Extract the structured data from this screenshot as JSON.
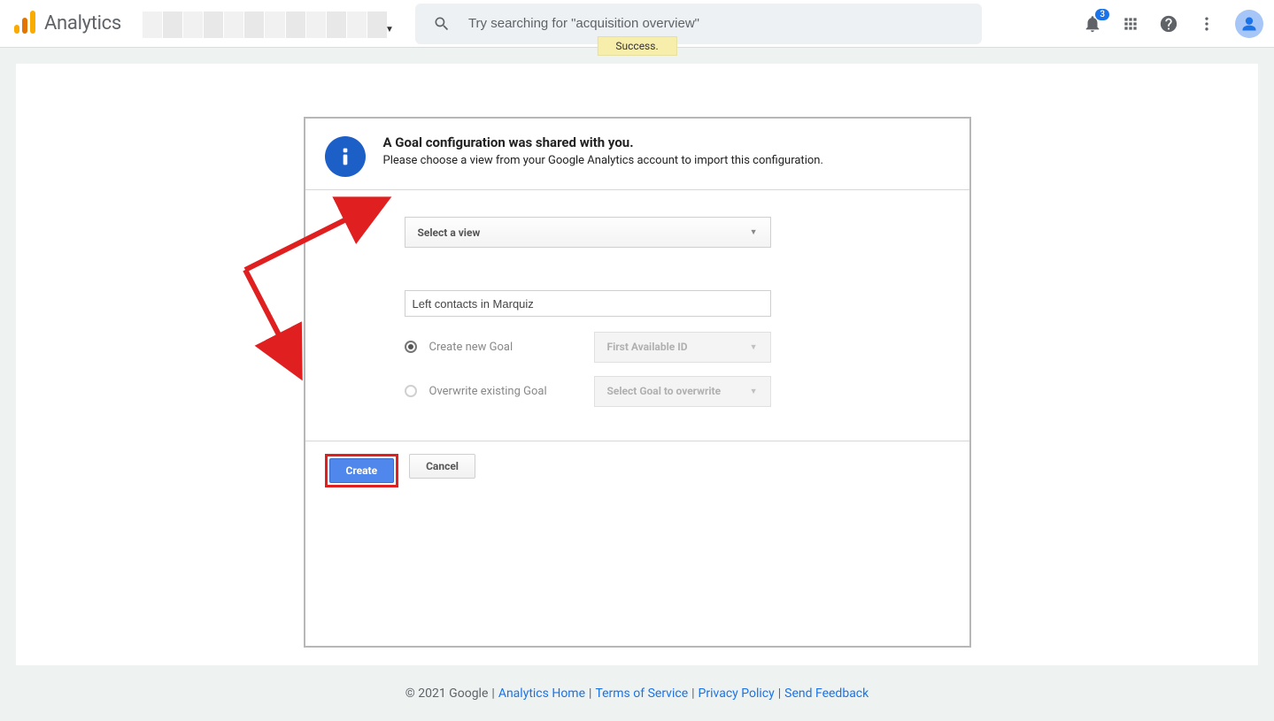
{
  "header": {
    "product_name": "Analytics",
    "search_placeholder": "Try searching for \"acquisition overview\"",
    "notification_count": "3"
  },
  "toast": {
    "message": "Success."
  },
  "modal": {
    "title": "A Goal configuration was shared with you.",
    "subtitle": "Please choose a view from your Google Analytics account to import this configuration.",
    "view_select_label": "Select a view",
    "goal_name_value": "Left contacts in Marquiz",
    "radios": {
      "create_label": "Create new Goal",
      "create_dd": "First Available ID",
      "overwrite_label": "Overwrite existing Goal",
      "overwrite_dd": "Select Goal to overwrite"
    },
    "buttons": {
      "create": "Create",
      "cancel": "Cancel"
    }
  },
  "footer": {
    "copyright": "© 2021 Google",
    "links": {
      "home": "Analytics Home",
      "tos": "Terms of Service",
      "privacy": "Privacy Policy",
      "feedback": "Send Feedback"
    }
  }
}
